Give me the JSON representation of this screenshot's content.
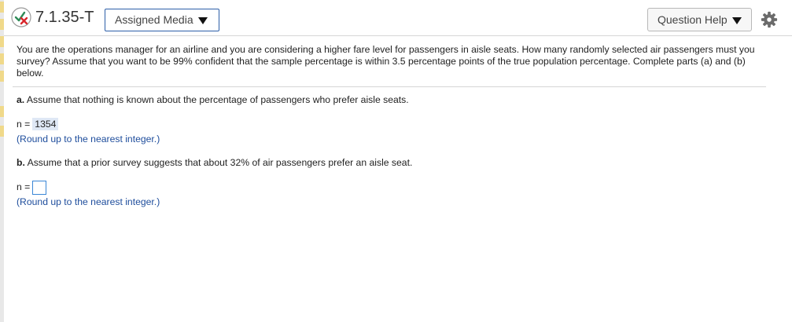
{
  "header": {
    "question_id": "7.1.35-T",
    "assigned_media_label": "Assigned Media",
    "question_help_label": "Question Help"
  },
  "problem": {
    "text": "You are the operations manager for an airline and you are considering a higher fare level for passengers in aisle seats. How many randomly selected air passengers must you survey? Assume that you want to be 99% confident that the sample percentage is within 3.5 percentage points of the true population percentage. Complete parts (a) and (b) below."
  },
  "part_a": {
    "label": "a.",
    "text": "Assume that nothing is known about the percentage of passengers who prefer aisle seats.",
    "answer_prefix": "n =",
    "answer_value": "1354",
    "hint": "(Round up to the nearest integer.)"
  },
  "part_b": {
    "label": "b.",
    "text": "Assume that a prior survey suggests that about 32% of air passengers prefer an aisle seat.",
    "answer_prefix": "n =",
    "answer_value": "",
    "hint": "(Round up to the nearest integer.)"
  },
  "colors": {
    "accent": "#2c5ea8",
    "hint_text": "#1e4d9c",
    "answer_highlight": "#dfe8f5",
    "status_check": "#2e8b57",
    "status_x": "#d9262b"
  }
}
